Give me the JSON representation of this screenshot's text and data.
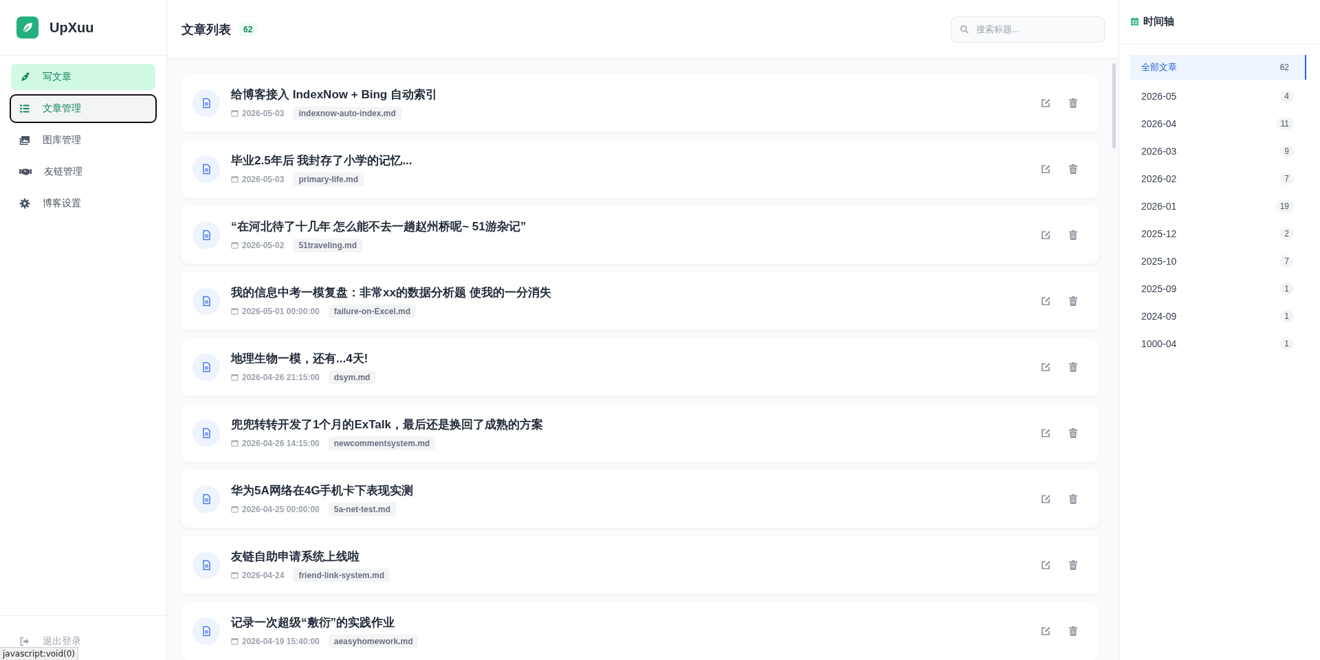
{
  "sidebar": {
    "brand": "UpXuu",
    "items": [
      {
        "label": "写文章",
        "kind": "action",
        "selected": false,
        "focused": false
      },
      {
        "label": "文章管理",
        "kind": "link",
        "selected": true,
        "focused": true
      },
      {
        "label": "图库管理",
        "kind": "link",
        "selected": false,
        "focused": false
      },
      {
        "label": "友链管理",
        "kind": "link",
        "selected": false,
        "focused": false
      },
      {
        "label": "博客设置",
        "kind": "link",
        "selected": false,
        "focused": false
      }
    ],
    "logout": "退出登录"
  },
  "header": {
    "title": "文章列表",
    "count": "62",
    "search": {
      "placeholder": "搜索标题..."
    }
  },
  "articles": [
    {
      "title": "给博客接入 IndexNow + Bing 自动索引",
      "date": "2026-05-03",
      "file": "indexnow-auto-index.md"
    },
    {
      "title": "毕业2.5年后 我封存了小学的记忆...",
      "date": "2026-05-03",
      "file": "primary-life.md"
    },
    {
      "title": "“在河北待了十几年 怎么能不去一趟赵州桥呢~ 51游杂记”",
      "date": "2026-05-02",
      "file": "51traveling.md"
    },
    {
      "title": "我的信息中考一模复盘：非常xx的数据分析题 使我的一分消失",
      "date": "2026-05-01 00:00:00",
      "file": "failure-on-Excel.md"
    },
    {
      "title": "地理生物一模，还有...4天!",
      "date": "2026-04-26 21:15:00",
      "file": "dsym.md"
    },
    {
      "title": "兜兜转转开发了1个月的ExTalk，最后还是换回了成熟的方案",
      "date": "2026-04-26 14:15:00",
      "file": "newcommentsystem.md"
    },
    {
      "title": "华为5A网络在4G手机卡下表现实测",
      "date": "2026-04-25 00:00:00",
      "file": "5a-net-test.md"
    },
    {
      "title": "友链自助申请系统上线啦",
      "date": "2026-04-24",
      "file": "friend-link-system.md"
    },
    {
      "title": "记录一次超级“敷衍”的实践作业",
      "date": "2026-04-19 15:40:00",
      "file": "aeasyhomework.md"
    }
  ],
  "timeline": {
    "title": "时间轴",
    "items": [
      {
        "label": "全部文章",
        "count": "62",
        "selected": true
      },
      {
        "label": "2026-05",
        "count": "4",
        "selected": false
      },
      {
        "label": "2026-04",
        "count": "11",
        "selected": false
      },
      {
        "label": "2026-03",
        "count": "9",
        "selected": false
      },
      {
        "label": "2026-02",
        "count": "7",
        "selected": false
      },
      {
        "label": "2026-01",
        "count": "19",
        "selected": false
      },
      {
        "label": "2025-12",
        "count": "2",
        "selected": false
      },
      {
        "label": "2025-10",
        "count": "7",
        "selected": false
      },
      {
        "label": "2025-09",
        "count": "1",
        "selected": false
      },
      {
        "label": "2024-09",
        "count": "1",
        "selected": false
      },
      {
        "label": "1000-04",
        "count": "1",
        "selected": false
      }
    ]
  },
  "status_bar": "javascript:void(0)"
}
